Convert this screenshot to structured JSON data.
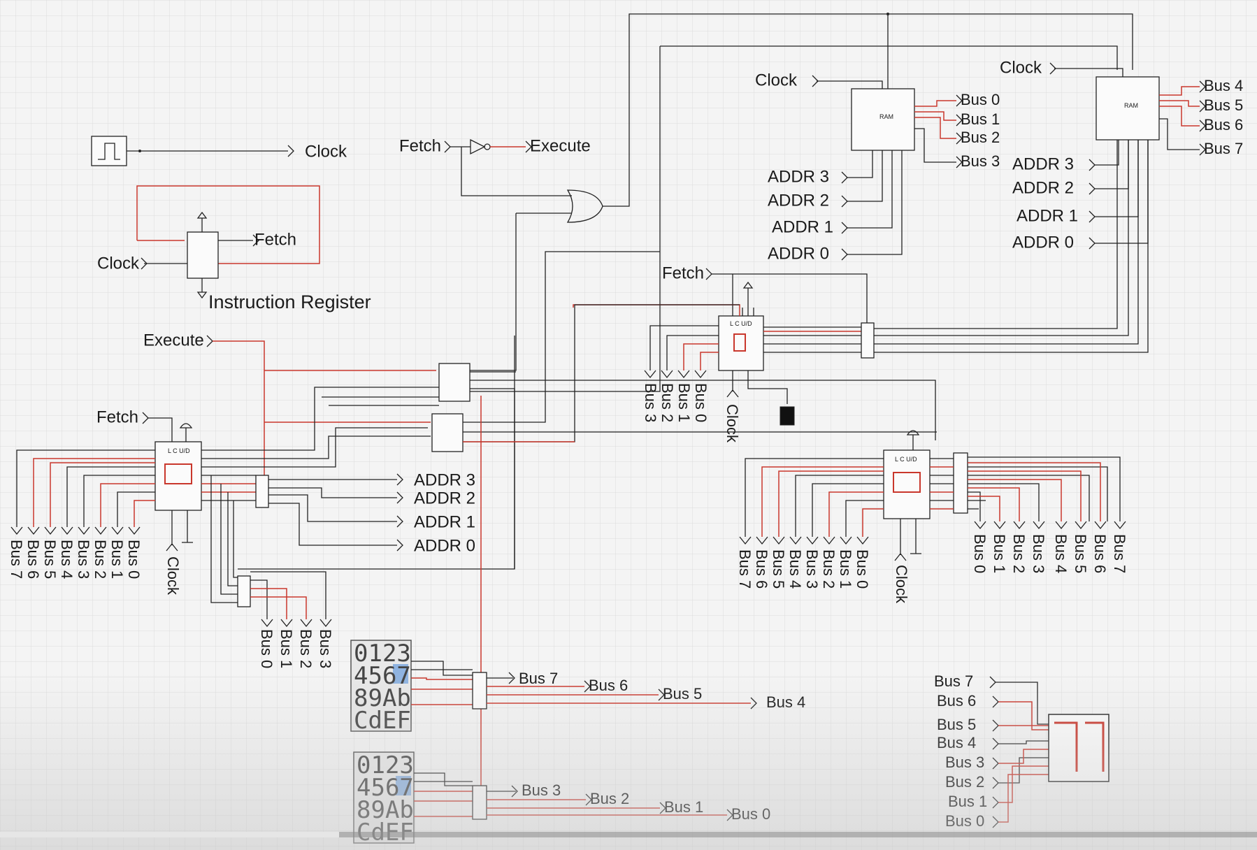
{
  "colors": {
    "wire": "#222222",
    "active_wire": "#c9372c",
    "grid": "#dcdcdc",
    "background": "#f4f4f4",
    "display_highlight": "#8fb3e0"
  },
  "top_left": {
    "clock_out": "Clock",
    "ir": {
      "title": "Instruction Register",
      "clock_in": "Clock",
      "fetch_out": "Fetch"
    },
    "fetch_in": "Fetch",
    "execute_out": "Execute"
  },
  "ram_left": {
    "clock": "Clock",
    "bus_outputs": [
      "Bus 0",
      "Bus 1",
      "Bus 2",
      "Bus 3"
    ],
    "addr_inputs": [
      "ADDR 3",
      "ADDR 2",
      "ADDR 1",
      "ADDR 0"
    ]
  },
  "ram_right": {
    "clock": "Clock",
    "bus_outputs": [
      "Bus 4",
      "Bus 5",
      "Bus 6",
      "Bus 7"
    ],
    "addr_inputs": [
      "ADDR 3",
      "ADDR 2",
      "ADDR 1",
      "ADDR 0"
    ]
  },
  "program_counter": {
    "fetch": "Fetch",
    "clock": "Clock",
    "bus_labels": [
      "Bus 3",
      "Bus 2",
      "Bus 1",
      "Bus 0"
    ]
  },
  "register_left": {
    "execute": "Execute",
    "fetch": "Fetch",
    "clock": "Clock",
    "bus_labels": [
      "Bus 7",
      "Bus 6",
      "Bus 5",
      "Bus 4",
      "Bus 3",
      "Bus 2",
      "Bus 1",
      "Bus 0"
    ],
    "addr_outputs": [
      "ADDR 3",
      "ADDR 2",
      "ADDR 1",
      "ADDR 0"
    ],
    "low_bus": [
      "Bus 0",
      "Bus 1",
      "Bus 2",
      "Bus 3"
    ]
  },
  "register_right": {
    "clock": "Clock",
    "bus_left": [
      "Bus 7",
      "Bus 6",
      "Bus 5",
      "Bus 4",
      "Bus 3",
      "Bus 2",
      "Bus 1",
      "Bus 0"
    ],
    "bus_right": [
      "Bus 0",
      "Bus 1",
      "Bus 2",
      "Bus 3",
      "Bus 4",
      "Bus 5",
      "Bus 6",
      "Bus 7"
    ]
  },
  "hex_keypad_upper": {
    "rows": [
      "0123",
      "4567",
      "89Ab",
      "CdEF"
    ],
    "outputs": [
      "Bus 7",
      "Bus 6",
      "Bus 5",
      "Bus 4"
    ]
  },
  "hex_keypad_lower": {
    "rows": [
      "0123",
      "4567",
      "89Ab",
      "CdEF"
    ],
    "outputs": [
      "Bus 3",
      "Bus 2",
      "Bus 1",
      "Bus 0"
    ]
  },
  "display_inputs": [
    "Bus 7",
    "Bus 6",
    "Bus 5",
    "Bus 4",
    "Bus 3",
    "Bus 2",
    "Bus 1",
    "Bus 0"
  ],
  "video_progress": 0.27
}
